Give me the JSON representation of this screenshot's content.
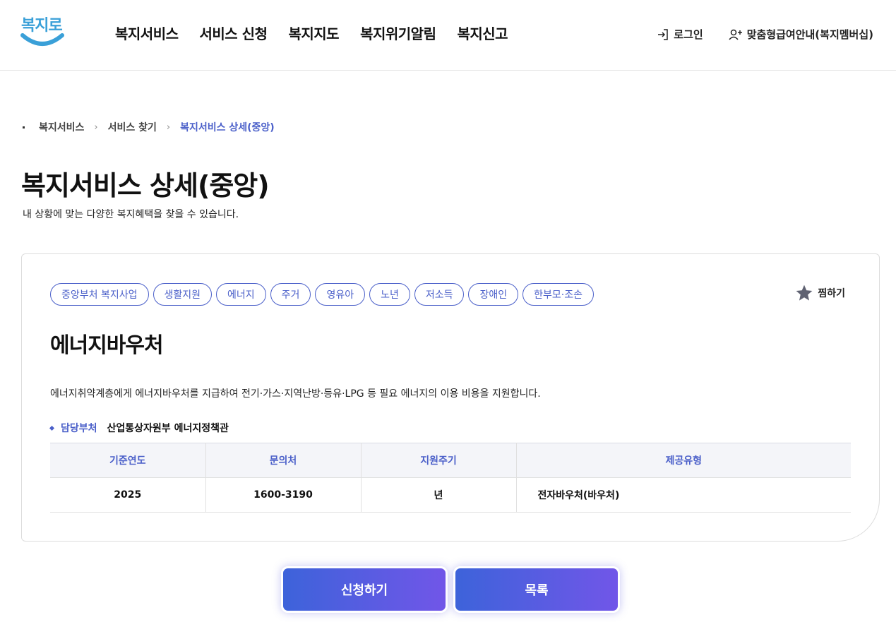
{
  "header": {
    "logo_text": "복지로",
    "nav": [
      "복지서비스",
      "서비스 신청",
      "복지지도",
      "복지위기알림",
      "복지신고"
    ],
    "login_label": "로그인",
    "membership_label": "맞춤형급여안내(복지멤버십)"
  },
  "breadcrumb": [
    "복지서비스",
    "서비스 찾기",
    "복지서비스 상세(중앙)"
  ],
  "page": {
    "title": "복지서비스 상세(중앙)",
    "description": "내 상황에 맞는 다양한 복지혜택을 찾을 수 있습니다."
  },
  "service": {
    "tags": [
      "중앙부처 복지사업",
      "생활지원",
      "에너지",
      "주거",
      "영유아",
      "노년",
      "저소득",
      "장애인",
      "한부모·조손"
    ],
    "bookmark_label": "찜하기",
    "title": "에너지바우처",
    "description": "에너지취약계층에게 에너지바우처를 지급하여 전기·가스·지역난방·등유·LPG 등 필요 에너지의 이용 비용을 지원합니다.",
    "dept_label": "담당부처",
    "dept_value": "산업통상자원부 에너지정책관",
    "table": {
      "headers": [
        "기준연도",
        "문의처",
        "지원주기",
        "제공유형"
      ],
      "row": [
        "2025",
        "1600-3190",
        "년",
        "전자바우처(바우처)"
      ]
    }
  },
  "actions": {
    "apply_label": "신청하기",
    "list_label": "목록"
  },
  "colors": {
    "accent": "#4a5fc9",
    "button_gradient_start": "#3d63da",
    "button_gradient_end": "#7156e8",
    "logo": "#3aa0d8"
  }
}
